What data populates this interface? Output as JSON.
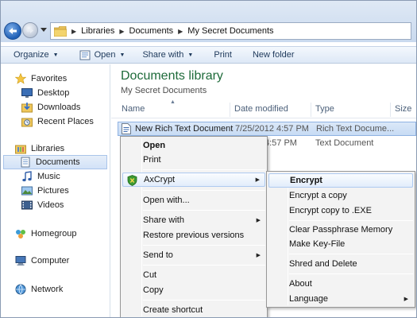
{
  "address": {
    "crumbs": [
      "Libraries",
      "Documents",
      "My Secret Documents"
    ]
  },
  "toolbar": {
    "organize": "Organize",
    "open": "Open",
    "share_with": "Share with",
    "print": "Print",
    "new_folder": "New folder"
  },
  "nav": {
    "favorites": "Favorites",
    "desktop": "Desktop",
    "downloads": "Downloads",
    "recent_places": "Recent Places",
    "libraries": "Libraries",
    "documents": "Documents",
    "music": "Music",
    "pictures": "Pictures",
    "videos": "Videos",
    "homegroup": "Homegroup",
    "computer": "Computer",
    "network": "Network"
  },
  "content": {
    "title": "Documents library",
    "subtitle": "My Secret Documents",
    "columns": {
      "name": "Name",
      "date_modified": "Date modified",
      "type": "Type",
      "size": "Size"
    },
    "files": [
      {
        "name": "New Rich Text Document",
        "date": "7/25/2012 4:57 PM",
        "type": "Rich Text Docume..."
      },
      {
        "name": "",
        "date": "4:57 PM",
        "type": "Text Document"
      }
    ]
  },
  "context_menu": {
    "open": "Open",
    "print": "Print",
    "axcrypt": "AxCrypt",
    "open_with": "Open with...",
    "share_with": "Share with",
    "restore_previous": "Restore previous versions",
    "send_to": "Send to",
    "cut": "Cut",
    "copy": "Copy",
    "create_shortcut": "Create shortcut"
  },
  "axcrypt_menu": {
    "encrypt": "Encrypt",
    "encrypt_copy": "Encrypt a copy",
    "encrypt_copy_exe": "Encrypt copy to .EXE",
    "clear_passphrase": "Clear Passphrase Memory",
    "make_keyfile": "Make Key-File",
    "shred_delete": "Shred and Delete",
    "about": "About",
    "language": "Language"
  },
  "colors": {
    "accent": "#1e6b3a",
    "selection": "#c7dbf4"
  },
  "icons": {
    "back": "back-arrow-icon",
    "forward": "forward-arrow-icon",
    "folder": "folder-icon",
    "star": "star-icon",
    "shield": "axcrypt-shield-icon"
  }
}
